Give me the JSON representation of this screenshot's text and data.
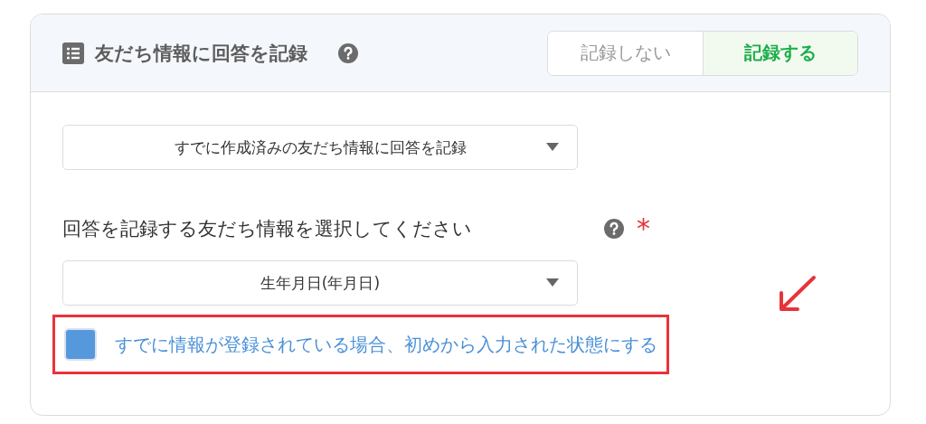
{
  "header": {
    "title": "友だち情報に回答を記録",
    "toggle": [
      {
        "label": "記録しない",
        "selected": false
      },
      {
        "label": "記録する",
        "selected": true
      }
    ]
  },
  "mode_select": {
    "value": "すでに作成済みの友だち情報に回答を記録"
  },
  "field": {
    "label": "回答を記録する友だち情報を選択してください",
    "required_mark": "*",
    "select": {
      "value": "生年月日(年月日)"
    }
  },
  "option": {
    "label": "すでに情報が登録されている場合、初めから入力された状態にする",
    "checked": true,
    "highlighted": true
  }
}
